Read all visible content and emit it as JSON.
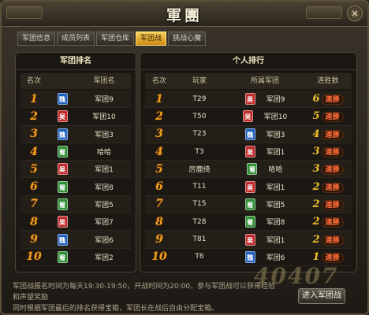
{
  "window": {
    "title": "軍團",
    "close_label": "×"
  },
  "tabs": [
    {
      "label": "军团信息",
      "active": false
    },
    {
      "label": "成员列表",
      "active": false
    },
    {
      "label": "军团仓库",
      "active": false
    },
    {
      "label": "军团战",
      "active": true
    },
    {
      "label": "挑战心魔",
      "active": false
    }
  ],
  "left_panel": {
    "title": "军团排名",
    "headers": {
      "rank": "名次",
      "name": "军团名"
    },
    "rows": [
      {
        "rank": "1",
        "badge": "魏",
        "badge_color": "#1f5fc0",
        "name": "军团9"
      },
      {
        "rank": "2",
        "badge": "吴",
        "badge_color": "#c02a2a",
        "name": "军团10"
      },
      {
        "rank": "3",
        "badge": "魏",
        "badge_color": "#1f5fc0",
        "name": "军团3"
      },
      {
        "rank": "4",
        "badge": "蜀",
        "badge_color": "#2e8f35",
        "name": "哈哈"
      },
      {
        "rank": "5",
        "badge": "吴",
        "badge_color": "#c02a2a",
        "name": "军团1"
      },
      {
        "rank": "6",
        "badge": "蜀",
        "badge_color": "#2e8f35",
        "name": "军团8"
      },
      {
        "rank": "7",
        "badge": "蜀",
        "badge_color": "#2e8f35",
        "name": "军团5"
      },
      {
        "rank": "8",
        "badge": "吴",
        "badge_color": "#c02a2a",
        "name": "军团7"
      },
      {
        "rank": "9",
        "badge": "魏",
        "badge_color": "#1f5fc0",
        "name": "军团6"
      },
      {
        "rank": "10",
        "badge": "蜀",
        "badge_color": "#2e8f35",
        "name": "军团2"
      }
    ]
  },
  "right_panel": {
    "title": "个人排行",
    "headers": {
      "rank": "名次",
      "player": "玩家",
      "legion": "所属军团",
      "streak": "连胜数"
    },
    "streak_suffix": "連勝",
    "rows": [
      {
        "rank": "1",
        "player": "T29",
        "badge": "吴",
        "badge_color": "#c02a2a",
        "legion": "军团9",
        "streak": "6"
      },
      {
        "rank": "2",
        "player": "T50",
        "badge": "吴",
        "badge_color": "#c02a2a",
        "legion": "军团10",
        "streak": "5"
      },
      {
        "rank": "3",
        "player": "T23",
        "badge": "魏",
        "badge_color": "#1f5fc0",
        "legion": "军团3",
        "streak": "4"
      },
      {
        "rank": "4",
        "player": "T3",
        "badge": "吴",
        "badge_color": "#c02a2a",
        "legion": "军团1",
        "streak": "3"
      },
      {
        "rank": "5",
        "player": "厉鹿绮",
        "badge": "蜀",
        "badge_color": "#2e8f35",
        "legion": "哈哈",
        "streak": "3"
      },
      {
        "rank": "6",
        "player": "T11",
        "badge": "吴",
        "badge_color": "#c02a2a",
        "legion": "军团1",
        "streak": "2"
      },
      {
        "rank": "7",
        "player": "T15",
        "badge": "蜀",
        "badge_color": "#2e8f35",
        "legion": "军团5",
        "streak": "2"
      },
      {
        "rank": "8",
        "player": "T28",
        "badge": "蜀",
        "badge_color": "#2e8f35",
        "legion": "军团8",
        "streak": "2"
      },
      {
        "rank": "9",
        "player": "T81",
        "badge": "吴",
        "badge_color": "#c02a2a",
        "legion": "军团1",
        "streak": "2"
      },
      {
        "rank": "10",
        "player": "T6",
        "badge": "魏",
        "badge_color": "#1f5fc0",
        "legion": "军团6",
        "streak": "1"
      }
    ]
  },
  "footer": {
    "line1": "军团战报名时间为每天19:30-19:50，开战时间为20:00，参与军团战可以获得经验和声望奖励",
    "line2": "同时根据军团最后的排名获得宝箱，军团长在战后自由分配宝箱。",
    "enter_button": "进入军团战"
  },
  "watermark": "40407"
}
